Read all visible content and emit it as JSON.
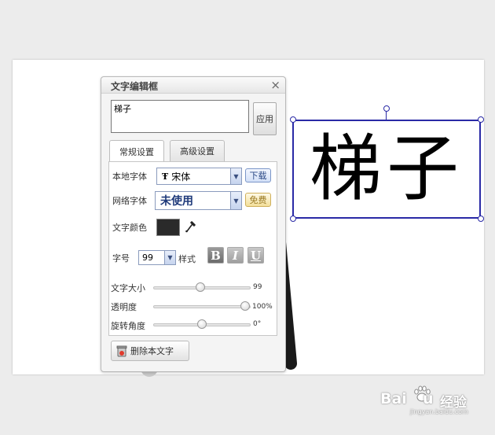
{
  "dialog": {
    "title": "文字编辑框",
    "text_value": "梯子",
    "apply_label": "应用",
    "tabs": [
      {
        "label": "常规设置",
        "active": true
      },
      {
        "label": "高级设置",
        "active": false
      }
    ],
    "local_font": {
      "label": "本地字体",
      "value": "宋体",
      "download_label": "下载"
    },
    "web_font": {
      "label": "网络字体",
      "value": "未使用",
      "free_label": "免费"
    },
    "text_color": {
      "label": "文字颜色",
      "value": "#2a2a2a"
    },
    "font_size": {
      "label": "字号",
      "value": "99"
    },
    "style_label": "样式",
    "style_buttons": [
      "B",
      "I",
      "U"
    ],
    "sliders": [
      {
        "label": "文字大小",
        "value_text": "99",
        "fraction": 0.4
      },
      {
        "label": "透明度",
        "value_text": "100%",
        "fraction": 1.0
      },
      {
        "label": "旋转角度",
        "value_text": "0°",
        "fraction": 0.5
      }
    ],
    "delete_label": "删除本文字"
  },
  "canvas": {
    "text": "梯子"
  },
  "watermark": {
    "brand": "Bai",
    "brand2": "u",
    "cn": "经验",
    "url": "jingyan.baidu.com"
  },
  "colors": {
    "selection": "#2a2aa6",
    "button_blue": "#2c4a86",
    "button_gold": "#9a7a23"
  }
}
